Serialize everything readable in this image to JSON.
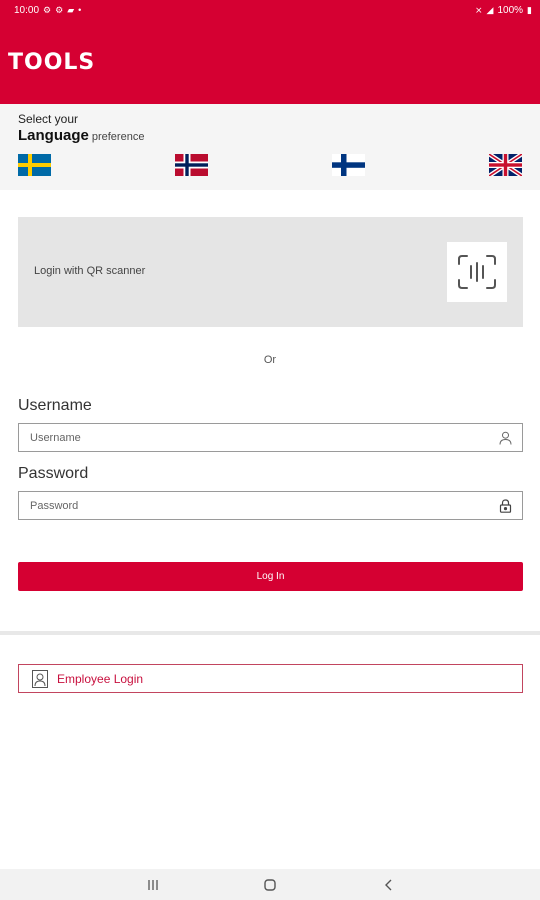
{
  "status_bar": {
    "time": "10:00",
    "battery": "100%",
    "left_icons": [
      "gear-icon",
      "gear-icon",
      "chat-icon",
      "dot-icon"
    ],
    "right_icons": [
      "mute-icon",
      "signal-icon",
      "battery-icon"
    ]
  },
  "app_bar": {
    "title": "TOOLS",
    "color": "#d50032"
  },
  "language": {
    "select_text": "Select your",
    "heading": "Language",
    "preference_text": "preference",
    "flags": [
      {
        "country": "Sweden",
        "icon": "sweden-flag-icon"
      },
      {
        "country": "Norway",
        "icon": "norway-flag-icon"
      },
      {
        "country": "Finland",
        "icon": "finland-flag-icon"
      },
      {
        "country": "United Kingdom",
        "icon": "uk-flag-icon"
      }
    ]
  },
  "qr_login": {
    "label": "Login with QR scanner",
    "icon": "qr-scan-icon"
  },
  "or_text": "Or",
  "username": {
    "label": "Username",
    "placeholder": "Username",
    "value": "",
    "icon": "user-icon"
  },
  "password": {
    "label": "Password",
    "placeholder": "Password",
    "value": "",
    "icon": "lock-icon"
  },
  "login_button": {
    "label": "Log In"
  },
  "employee_login": {
    "label": "Employee Login",
    "icon": "employee-icon",
    "accent": "#c8103e"
  },
  "nav_bar": {
    "recent_icon": "recent-apps-icon",
    "home_icon": "home-icon",
    "back_icon": "back-icon"
  }
}
